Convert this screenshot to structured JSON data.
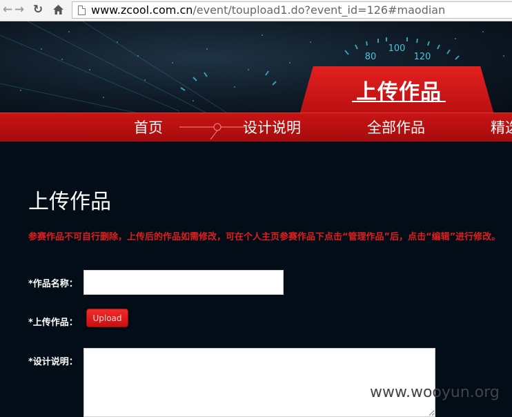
{
  "browser": {
    "back_icon": "back-arrow-icon",
    "forward_icon": "forward-arrow-icon",
    "reload_icon": "reload-icon",
    "home_icon": "home-icon",
    "url_host": "www.zcool.com.cn",
    "url_path": "/event/toupload1.do?event_id=126#maodian"
  },
  "banner": {
    "gauge_ticks": [
      "80",
      "100",
      "120"
    ],
    "upload_tab_label": "上传作品"
  },
  "nav": {
    "items": [
      {
        "label": "首页"
      },
      {
        "label": "设计说明"
      },
      {
        "label": "全部作品"
      },
      {
        "label": "精选"
      }
    ]
  },
  "main": {
    "heading": "上传作品",
    "notice": "参赛作品不可自行删除，上传后的作品如需修改，可在个人主页参赛作品下点击“管理作品”后，点击“编辑”进行修改。",
    "form": {
      "name_label": "*作品名称：",
      "name_value": "",
      "upload_label": "*上传作品：",
      "upload_button": "Upload",
      "desc_label": "*设计说明：",
      "desc_value": ""
    }
  },
  "watermark": "www.wooyun.org",
  "colors": {
    "accent_red": "#d11616",
    "page_bg": "#020d18"
  }
}
